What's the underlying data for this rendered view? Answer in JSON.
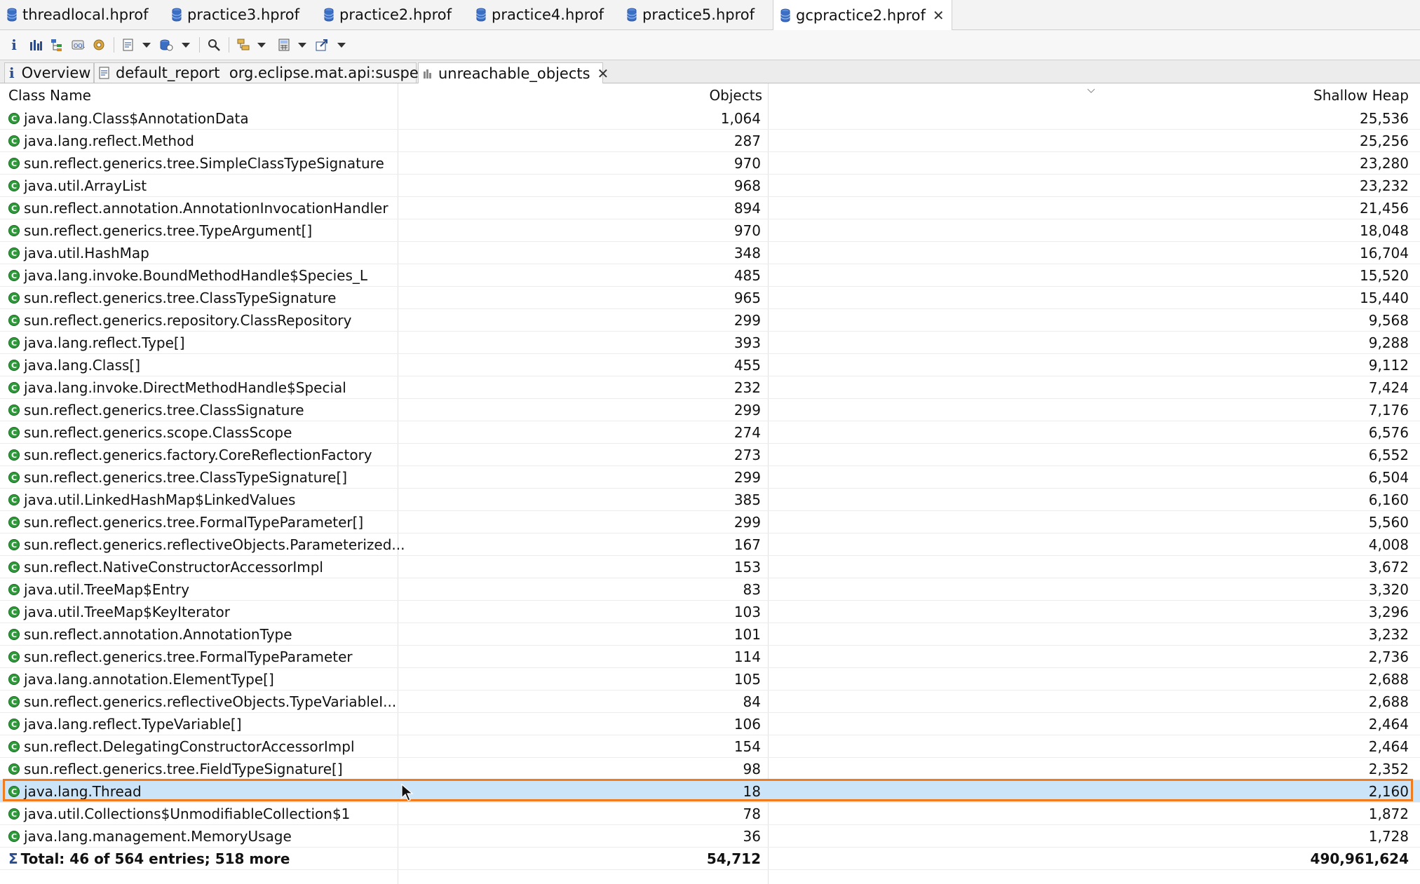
{
  "editor_tabs": [
    {
      "label": "threadlocal.hprof",
      "active": false
    },
    {
      "label": "practice3.hprof",
      "active": false
    },
    {
      "label": "practice2.hprof",
      "active": false
    },
    {
      "label": "practice4.hprof",
      "active": false
    },
    {
      "label": "practice5.hprof",
      "active": false
    },
    {
      "label": "gcpractice2.hprof",
      "active": true
    }
  ],
  "sub_tabs": [
    {
      "label": "Overview"
    },
    {
      "label": "default_report  org.eclipse.mat.api:suspects"
    },
    {
      "label": "unreachable_objects"
    }
  ],
  "columns": {
    "class_name": "Class Name",
    "objects": "Objects",
    "shallow_heap": "Shallow Heap"
  },
  "rows": [
    {
      "name": "java.lang.Class$AnnotationData",
      "objects": "1,064",
      "heap": "25,536"
    },
    {
      "name": "java.lang.reflect.Method",
      "objects": "287",
      "heap": "25,256"
    },
    {
      "name": "sun.reflect.generics.tree.SimpleClassTypeSignature",
      "objects": "970",
      "heap": "23,280"
    },
    {
      "name": "java.util.ArrayList",
      "objects": "968",
      "heap": "23,232"
    },
    {
      "name": "sun.reflect.annotation.AnnotationInvocationHandler",
      "objects": "894",
      "heap": "21,456"
    },
    {
      "name": "sun.reflect.generics.tree.TypeArgument[]",
      "objects": "970",
      "heap": "18,048"
    },
    {
      "name": "java.util.HashMap",
      "objects": "348",
      "heap": "16,704"
    },
    {
      "name": "java.lang.invoke.BoundMethodHandle$Species_L",
      "objects": "485",
      "heap": "15,520"
    },
    {
      "name": "sun.reflect.generics.tree.ClassTypeSignature",
      "objects": "965",
      "heap": "15,440"
    },
    {
      "name": "sun.reflect.generics.repository.ClassRepository",
      "objects": "299",
      "heap": "9,568"
    },
    {
      "name": "java.lang.reflect.Type[]",
      "objects": "393",
      "heap": "9,288"
    },
    {
      "name": "java.lang.Class[]",
      "objects": "455",
      "heap": "9,112"
    },
    {
      "name": "java.lang.invoke.DirectMethodHandle$Special",
      "objects": "232",
      "heap": "7,424"
    },
    {
      "name": "sun.reflect.generics.tree.ClassSignature",
      "objects": "299",
      "heap": "7,176"
    },
    {
      "name": "sun.reflect.generics.scope.ClassScope",
      "objects": "274",
      "heap": "6,576"
    },
    {
      "name": "sun.reflect.generics.factory.CoreReflectionFactory",
      "objects": "273",
      "heap": "6,552"
    },
    {
      "name": "sun.reflect.generics.tree.ClassTypeSignature[]",
      "objects": "299",
      "heap": "6,504"
    },
    {
      "name": "java.util.LinkedHashMap$LinkedValues",
      "objects": "385",
      "heap": "6,160"
    },
    {
      "name": "sun.reflect.generics.tree.FormalTypeParameter[]",
      "objects": "299",
      "heap": "5,560"
    },
    {
      "name": "sun.reflect.generics.reflectiveObjects.Parameterized...",
      "objects": "167",
      "heap": "4,008"
    },
    {
      "name": "sun.reflect.NativeConstructorAccessorImpl",
      "objects": "153",
      "heap": "3,672"
    },
    {
      "name": "java.util.TreeMap$Entry",
      "objects": "83",
      "heap": "3,320"
    },
    {
      "name": "java.util.TreeMap$KeyIterator",
      "objects": "103",
      "heap": "3,296"
    },
    {
      "name": "sun.reflect.annotation.AnnotationType",
      "objects": "101",
      "heap": "3,232"
    },
    {
      "name": "sun.reflect.generics.tree.FormalTypeParameter",
      "objects": "114",
      "heap": "2,736"
    },
    {
      "name": "java.lang.annotation.ElementType[]",
      "objects": "105",
      "heap": "2,688"
    },
    {
      "name": "sun.reflect.generics.reflectiveObjects.TypeVariableI...",
      "objects": "84",
      "heap": "2,688"
    },
    {
      "name": "java.lang.reflect.TypeVariable[]",
      "objects": "106",
      "heap": "2,464"
    },
    {
      "name": "sun.reflect.DelegatingConstructorAccessorImpl",
      "objects": "154",
      "heap": "2,464"
    },
    {
      "name": "sun.reflect.generics.tree.FieldTypeSignature[]",
      "objects": "98",
      "heap": "2,352"
    },
    {
      "name": "java.lang.Thread",
      "objects": "18",
      "heap": "2,160",
      "selected": true
    },
    {
      "name": "java.util.Collections$UnmodifiableCollection$1",
      "objects": "78",
      "heap": "1,872"
    },
    {
      "name": "java.lang.management.MemoryUsage",
      "objects": "36",
      "heap": "1,728"
    }
  ],
  "total": {
    "label": "Total: 46 of 564 entries; 518 more",
    "objects": "54,712",
    "heap": "490,961,624"
  },
  "colors": {
    "accent_selected": "#cce4f7",
    "selection_border": "#f07c1e",
    "class_icon": "#2f9a3a",
    "db_icon": "#3b6fc4"
  }
}
